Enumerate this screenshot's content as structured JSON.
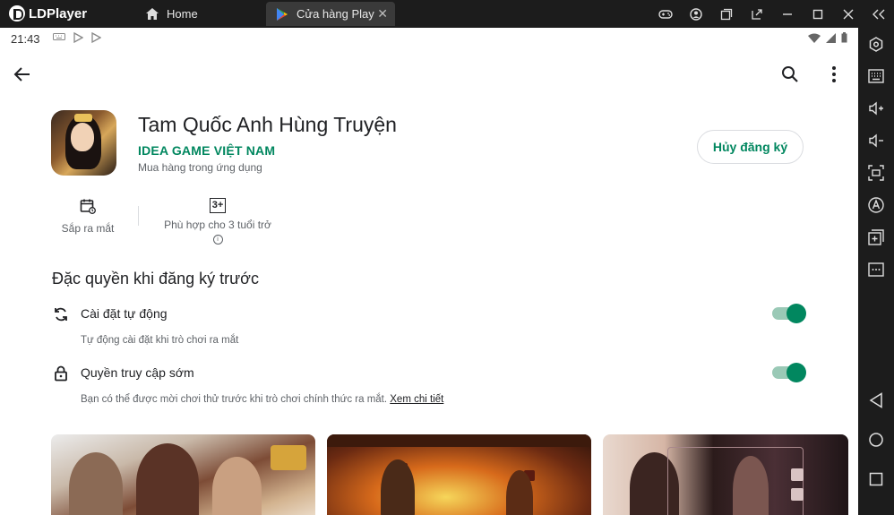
{
  "titlebar": {
    "brand": "LDPlayer",
    "tabs": [
      {
        "label": "Home",
        "icon": "home-icon"
      },
      {
        "label": "Cửa hàng Play",
        "icon": "play-store-icon",
        "active": true
      }
    ],
    "window_controls": [
      "gamepad-icon",
      "account-icon",
      "multi-instance-icon",
      "popout-icon",
      "minimize-icon",
      "maximize-icon",
      "close-icon",
      "collapse-sidebar-icon"
    ]
  },
  "statusbar": {
    "time": "21:43"
  },
  "app": {
    "title": "Tam Quốc Anh Hùng Truyện",
    "developer": "IDEA GAME VIỆT NAM",
    "in_app_purchases": "Mua hàng trong ứng dụng",
    "unregister_button": "Hủy đăng ký",
    "stats": [
      {
        "label": "Sắp ra mắt",
        "icon": "calendar-icon"
      },
      {
        "label": "Phù hợp cho 3 tuổi trở",
        "badge": "3+",
        "icon": "info-icon"
      }
    ]
  },
  "perks": {
    "section_title": "Đặc quyền khi đăng ký trước",
    "items": [
      {
        "title": "Cài đặt tự động",
        "description": "Tự động cài đặt khi trò chơi ra mắt",
        "icon": "sync-icon",
        "enabled": true
      },
      {
        "title": "Quyền truy cập sớm",
        "description": "Bạn có thể được mời chơi thử trước khi trò chơi chính thức ra mắt.",
        "link": "Xem chi tiết",
        "icon": "lock-icon",
        "enabled": true
      }
    ]
  },
  "colors": {
    "accent": "#01875f",
    "toggle_track": "#9ac9b6",
    "chrome_bg": "#1c1c1c"
  },
  "sidebar_icons": [
    "settings-icon",
    "keyboard-icon",
    "volume-up-icon",
    "volume-down-icon",
    "screenshot-icon",
    "auto-translate-icon",
    "add-app-icon",
    "more-icon",
    "android-back-icon",
    "android-home-icon",
    "android-recents-icon"
  ]
}
